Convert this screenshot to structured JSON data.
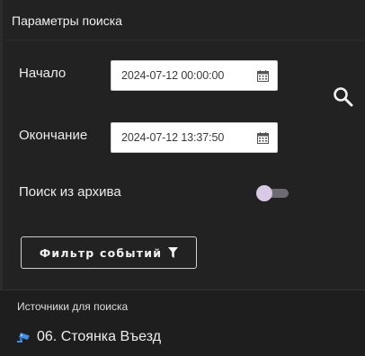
{
  "panel": {
    "title": "Параметры поиска"
  },
  "start": {
    "label": "Начало",
    "value": "2024-07-12 00:00:00"
  },
  "end": {
    "label": "Окончание",
    "value": "2024-07-12 13:37:50"
  },
  "archive": {
    "label": "Поиск из архива",
    "enabled": false
  },
  "filter": {
    "label": "Фильтр событий"
  },
  "sources": {
    "title": "Источники для поиска",
    "items": [
      {
        "label": "06. Стоянка Въезд",
        "icon": "camera-icon"
      }
    ]
  },
  "colors": {
    "background": "#1a1a1a",
    "panel": "#222222",
    "toggle_knob": "#d8c9e6",
    "camera_icon": "#3f8fe8"
  }
}
